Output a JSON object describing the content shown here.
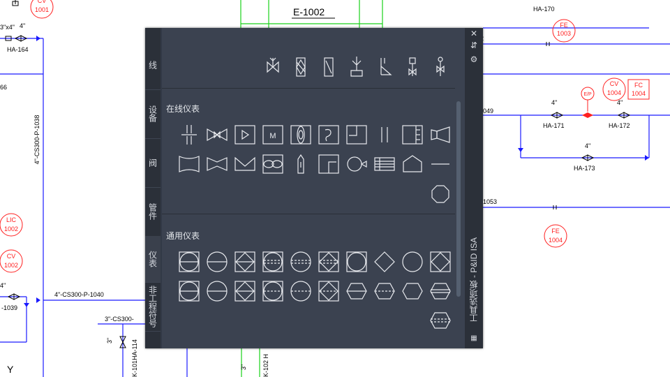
{
  "drawing": {
    "equipment": "E-1002",
    "lines": [
      "4\"-CS300-P-1038",
      "4\"-CS300-P-1040",
      "3\"-CS300-",
      "4\"",
      "3\"x4\"",
      "4\"",
      "3\"",
      "3\""
    ],
    "valves": [
      "HA-164",
      "HA-170",
      "HA-171",
      "HA-172",
      "HA-173",
      "-1039",
      "K-101HA-114",
      "K-102 H"
    ],
    "partial_text": [
      "66",
      "049",
      "1053",
      "2",
      "Y",
      "4\"",
      "4\"",
      "4\""
    ],
    "tags": [
      {
        "l1": "CV",
        "l2": "1001"
      },
      {
        "l1": "FE",
        "l2": "1003"
      },
      {
        "l1": "CV",
        "l2": "1004"
      },
      {
        "l1": "FC",
        "l2": "1004"
      },
      {
        "l1": "E/P",
        "l2": ""
      },
      {
        "l1": "LIC",
        "l2": "1002"
      },
      {
        "l1": "CV",
        "l2": "1002"
      },
      {
        "l1": "FE",
        "l2": "1004"
      }
    ],
    "colors": {
      "line": "#1a1aff",
      "instrument": "#ff2020",
      "equipment": "#19d219",
      "text": "#000000"
    }
  },
  "palette": {
    "title": "工具选项板 - P&ID ISA",
    "tabs": [
      "线",
      "设备",
      "阀",
      "管件",
      "仪表",
      "非工程符号"
    ],
    "active_tab": "仪表",
    "sections": [
      "在线仪表",
      "通用仪表"
    ],
    "buttons": {
      "close": "✕",
      "autohide": "⇵",
      "properties": "⚙"
    },
    "colors": {
      "background": "#3b4250",
      "tabs": "#2b3039",
      "icon": "#e8eaee"
    }
  }
}
